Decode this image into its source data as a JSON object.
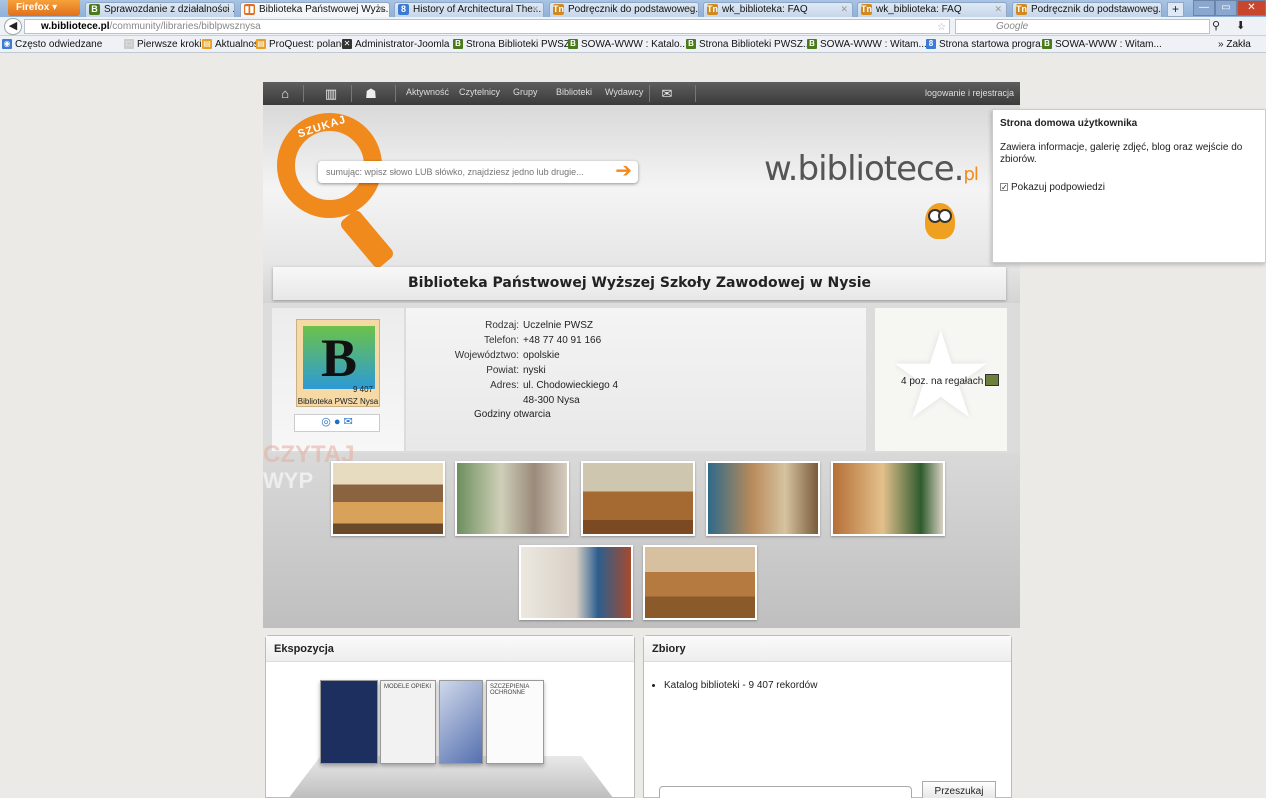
{
  "browser": {
    "menu_label": "Firefox",
    "tabs": [
      {
        "label": "Sprawozdanie z działalności ...",
        "icon": "B",
        "color": "#4a7a1c"
      },
      {
        "label": "Biblioteka Państwowej Wyżs...",
        "icon": "▮▮",
        "color": "#e07020"
      },
      {
        "label": "History of Architectural The...",
        "icon": "8",
        "color": "#3b7bd6"
      },
      {
        "label": "Podręcznik do podstawoweg...",
        "icon": "Tn",
        "color": "#d08a20"
      },
      {
        "label": "wk_biblioteka: FAQ",
        "icon": "Tn",
        "color": "#d08a20"
      },
      {
        "label": "wk_biblioteka: FAQ",
        "icon": "Tn",
        "color": "#d08a20"
      },
      {
        "label": "wk_biblioteka: FAQ",
        "icon": "Tn",
        "color": "#d08a20"
      },
      {
        "label": "Podręcznik do podstawoweg...",
        "icon": "Tn",
        "color": "#d08a20"
      }
    ],
    "new_tab": "+",
    "url_domain": "w.bibliotece.pl",
    "url_path": "/community/libraries/biblpwsznysa",
    "search_placeholder": "Google",
    "bookmarks": [
      {
        "label": "Często odwiedzane",
        "icon": "◉",
        "color": "#3b7bd6"
      },
      {
        "label": "Pierwsze kroki",
        "icon": "□",
        "color": "#cccccc"
      },
      {
        "label": "Aktualności",
        "icon": "▤",
        "color": "#e8a020"
      },
      {
        "label": "ProQuest: poland",
        "icon": "▤",
        "color": "#e8a020"
      },
      {
        "label": "Administrator-Joomla",
        "icon": "✕",
        "color": "#333333"
      },
      {
        "label": "Strona Biblioteki PWSZ...",
        "icon": "B",
        "color": "#4a7a1c"
      },
      {
        "label": "SOWA-WWW : Katalo...",
        "icon": "B",
        "color": "#4a7a1c"
      },
      {
        "label": "Strona Biblioteki PWSZ...",
        "icon": "B",
        "color": "#4a7a1c"
      },
      {
        "label": "SOWA-WWW : Witam...",
        "icon": "B",
        "color": "#4a7a1c"
      },
      {
        "label": "Strona startowa progra...",
        "icon": "8",
        "color": "#3b7bd6"
      },
      {
        "label": "SOWA-WWW : Witam...",
        "icon": "B",
        "color": "#4a7a1c"
      }
    ],
    "bookmarks_more": "» Zakła"
  },
  "site": {
    "nav_links": [
      "Aktywność",
      "Czytelnicy",
      "Grupy",
      "Biblioteki",
      "Wydawcy"
    ],
    "login": "logowanie i rejestracja",
    "search_badge": "SZUKAJ",
    "search_placeholder": "sumując: wpisz słowo LUB słówko, znajdziesz jedno lub drugie...",
    "logo": "w.bibliotece.",
    "logo_suffix": "pl"
  },
  "tooltip": {
    "title": "Strona domowa użytkownika",
    "text": "Zawiera informacje, galerię zdjęć, blog oraz wejście do zbiorów.",
    "checkbox_label": "Pokazuj podpowiedzi"
  },
  "library": {
    "title": "Biblioteka Państwowej Wyższej Szkoły Zawodowej w Nysie",
    "cover_letter": "B",
    "cover_count": "9 407",
    "cover_name": "Biblioteka PWSZ Nysa",
    "details": [
      {
        "label": "Rodzaj:",
        "value": "Uczelnie PWSZ"
      },
      {
        "label": "Telefon:",
        "value": "+48 77 40 91 166"
      },
      {
        "label": "Województwo:",
        "value": "opolskie"
      },
      {
        "label": "Powiat:",
        "value": "nyski"
      },
      {
        "label": "Adres:",
        "value": "ul. Chodowieckiego 4"
      },
      {
        "label": "",
        "value": "48-300 Nysa"
      }
    ],
    "hours": "Godziny otwarcia",
    "shelf": "4 poz. na regałach"
  },
  "gallery": {
    "watermark_1": "CZYTAJ",
    "watermark_2": "WYP"
  },
  "panels": {
    "ekspozycja_title": "Ekspozycja",
    "book_titles": [
      "MODELE OPIEKI",
      "SZCZEPIENIA OCHRONNE"
    ],
    "zbiory_title": "Zbiory",
    "zbiory_item": "Katalog biblioteki - 9 407 rekordów",
    "search_button": "Przeszukaj"
  }
}
